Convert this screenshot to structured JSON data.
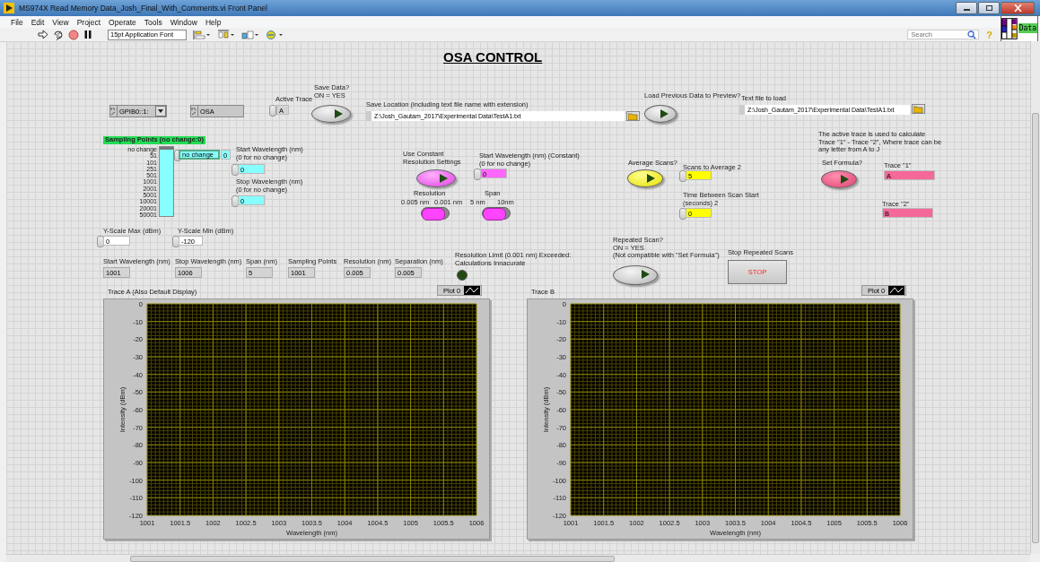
{
  "window": {
    "title": "MS974X  Read Memory Data_Josh_Final_With_Comments.vi Front Panel"
  },
  "menu": [
    "File",
    "Edit",
    "View",
    "Project",
    "Operate",
    "Tools",
    "Window",
    "Help"
  ],
  "toolbar": {
    "font": "15pt Application Font",
    "search": {
      "placeholder": "Search"
    },
    "help": "?",
    "vi_icon": {
      "label": "Data"
    }
  },
  "panel": {
    "heading": "OSA CONTROL",
    "gpib": {
      "value": "GPIB0::1:"
    },
    "instrument": {
      "value": "OSA"
    },
    "active_trace": {
      "label": "Active Trace",
      "value": "A"
    },
    "save_data": {
      "label": "Save Data?\nON = YES"
    },
    "save_location": {
      "label": "Save Location (including text file name with extension)",
      "value": "Z:\\Josh_Gautam_2017\\Experimental Data\\TestA1.txt"
    },
    "load_previous": {
      "label": "Load Previous Data to Preview?"
    },
    "text_file": {
      "label": "Text file to load",
      "value": "Z:\\Josh_Gautam_2017\\Experimental Data\\TestA1.txt"
    },
    "sampling_points": {
      "label": "Sampling Points (no change:0)",
      "ticks": [
        "no change",
        "51",
        "101",
        "251",
        "501",
        "1001",
        "2001",
        "5001",
        "10001",
        "20001",
        "50001"
      ],
      "level": 0,
      "ring_value": "no change",
      "numeric": "0"
    },
    "start_wl": {
      "label": "Start Wavelength (nm)\n(0 for no change)",
      "value": "0"
    },
    "stop_wl": {
      "label": "Stop Wavelength (nm)\n(0 for no change)",
      "value": "0"
    },
    "constant_res": {
      "label": "Use Constant\nResolution Settings"
    },
    "const_start": {
      "label": "Start Wavelength (nm) (Constant)\n(0 for no change)",
      "value": "0"
    },
    "resolution_switch": {
      "label": "Resolution",
      "left": "0.005 nm",
      "right": "0.001 nm",
      "on": false
    },
    "span_switch": {
      "label": "Span",
      "left": "5 nm",
      "right": "10nm",
      "on": false
    },
    "average": {
      "label": "Average Scans?"
    },
    "scans_to_average": {
      "label": "Scans to Average 2",
      "value": "5"
    },
    "time_between": {
      "label": "Time Between Scan Start\n(seconds) 2",
      "value": "0"
    },
    "formula_note": "The active trace is used to calculate\nTrace \"1\" - Trace \"2\", Where trace can be\nany letter from A to J",
    "set_formula": {
      "label": "Set Formula?"
    },
    "trace1": {
      "label": "Trace \"1\"",
      "value": "A"
    },
    "trace2": {
      "label": "Trace \"2\"",
      "value": "B"
    },
    "y_max": {
      "label": "Y-Scale Max (dBm)",
      "value": "0"
    },
    "y_min": {
      "label": "Y-Scale Min (dBm)",
      "value": "-120"
    },
    "indicators": [
      {
        "label": "Start Wavelength (nm)",
        "value": "1001"
      },
      {
        "label": "Stop Wavelength (nm)",
        "value": "1006"
      },
      {
        "label": "Span (nm)",
        "value": "5"
      },
      {
        "label": "Sampling Points",
        "value": "1001"
      },
      {
        "label": "Resolution (nm)",
        "value": "0.005"
      },
      {
        "label": "Separation (nm)",
        "value": "0.005"
      }
    ],
    "resolution_limit": {
      "label": "Resolution Limit (0.001 nm) Exceeded:\nCalculations Innacurate",
      "on": false
    },
    "repeated": {
      "label": "Repeated Scan?\nON = YES\n(Not compatible with \"Set Formula\")"
    },
    "stop": {
      "label": "Stop Repeated Scans",
      "text": "STOP"
    },
    "graphs": [
      {
        "title": "Trace A (Also Default Display)",
        "legend": "Plot 0",
        "chart_data": {
          "type": "line",
          "grid": true,
          "xlabel": "Wavelength (nm)",
          "ylabel": "Intensity (dBm)",
          "xlim": [
            1001,
            1006
          ],
          "ylim": [
            -120,
            0
          ],
          "xticks": [
            1001,
            1001.5,
            1002,
            1002.5,
            1003,
            1003.5,
            1004,
            1004.5,
            1005,
            1005.5,
            1006
          ],
          "yticks": [
            0,
            -10,
            -20,
            -30,
            -40,
            -50,
            -60,
            -70,
            -80,
            -90,
            -100,
            -110,
            -120
          ]
        }
      },
      {
        "title": "Trace B",
        "legend": "Plot 0",
        "chart_data": {
          "type": "line",
          "grid": true,
          "xlabel": "Wavelength (nm)",
          "ylabel": "Intensity (dBm)",
          "xlim": [
            1001,
            1006
          ],
          "ylim": [
            -120,
            0
          ],
          "xticks": [
            1001,
            1001.5,
            1002,
            1002.5,
            1003,
            1003.5,
            1004,
            1004.5,
            1005,
            1005.5,
            1006
          ],
          "yticks": [
            0,
            -10,
            -20,
            -30,
            -40,
            -50,
            -60,
            -70,
            -80,
            -90,
            -100,
            -110,
            -120
          ]
        }
      }
    ]
  }
}
